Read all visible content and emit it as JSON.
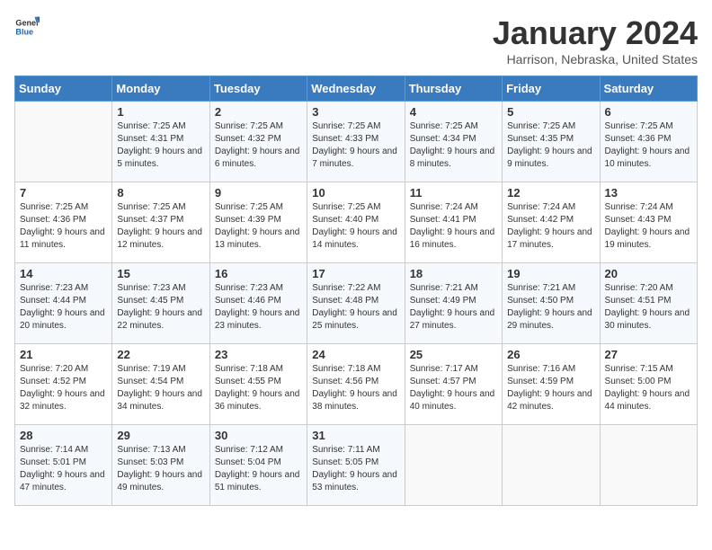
{
  "logo": {
    "text_general": "General",
    "text_blue": "Blue"
  },
  "header": {
    "month": "January 2024",
    "location": "Harrison, Nebraska, United States"
  },
  "weekdays": [
    "Sunday",
    "Monday",
    "Tuesday",
    "Wednesday",
    "Thursday",
    "Friday",
    "Saturday"
  ],
  "weeks": [
    [
      {
        "day": "",
        "sunrise": "",
        "sunset": "",
        "daylight": ""
      },
      {
        "day": "1",
        "sunrise": "Sunrise: 7:25 AM",
        "sunset": "Sunset: 4:31 PM",
        "daylight": "Daylight: 9 hours and 5 minutes."
      },
      {
        "day": "2",
        "sunrise": "Sunrise: 7:25 AM",
        "sunset": "Sunset: 4:32 PM",
        "daylight": "Daylight: 9 hours and 6 minutes."
      },
      {
        "day": "3",
        "sunrise": "Sunrise: 7:25 AM",
        "sunset": "Sunset: 4:33 PM",
        "daylight": "Daylight: 9 hours and 7 minutes."
      },
      {
        "day": "4",
        "sunrise": "Sunrise: 7:25 AM",
        "sunset": "Sunset: 4:34 PM",
        "daylight": "Daylight: 9 hours and 8 minutes."
      },
      {
        "day": "5",
        "sunrise": "Sunrise: 7:25 AM",
        "sunset": "Sunset: 4:35 PM",
        "daylight": "Daylight: 9 hours and 9 minutes."
      },
      {
        "day": "6",
        "sunrise": "Sunrise: 7:25 AM",
        "sunset": "Sunset: 4:36 PM",
        "daylight": "Daylight: 9 hours and 10 minutes."
      }
    ],
    [
      {
        "day": "7",
        "sunrise": "Sunrise: 7:25 AM",
        "sunset": "Sunset: 4:36 PM",
        "daylight": "Daylight: 9 hours and 11 minutes."
      },
      {
        "day": "8",
        "sunrise": "Sunrise: 7:25 AM",
        "sunset": "Sunset: 4:37 PM",
        "daylight": "Daylight: 9 hours and 12 minutes."
      },
      {
        "day": "9",
        "sunrise": "Sunrise: 7:25 AM",
        "sunset": "Sunset: 4:39 PM",
        "daylight": "Daylight: 9 hours and 13 minutes."
      },
      {
        "day": "10",
        "sunrise": "Sunrise: 7:25 AM",
        "sunset": "Sunset: 4:40 PM",
        "daylight": "Daylight: 9 hours and 14 minutes."
      },
      {
        "day": "11",
        "sunrise": "Sunrise: 7:24 AM",
        "sunset": "Sunset: 4:41 PM",
        "daylight": "Daylight: 9 hours and 16 minutes."
      },
      {
        "day": "12",
        "sunrise": "Sunrise: 7:24 AM",
        "sunset": "Sunset: 4:42 PM",
        "daylight": "Daylight: 9 hours and 17 minutes."
      },
      {
        "day": "13",
        "sunrise": "Sunrise: 7:24 AM",
        "sunset": "Sunset: 4:43 PM",
        "daylight": "Daylight: 9 hours and 19 minutes."
      }
    ],
    [
      {
        "day": "14",
        "sunrise": "Sunrise: 7:23 AM",
        "sunset": "Sunset: 4:44 PM",
        "daylight": "Daylight: 9 hours and 20 minutes."
      },
      {
        "day": "15",
        "sunrise": "Sunrise: 7:23 AM",
        "sunset": "Sunset: 4:45 PM",
        "daylight": "Daylight: 9 hours and 22 minutes."
      },
      {
        "day": "16",
        "sunrise": "Sunrise: 7:23 AM",
        "sunset": "Sunset: 4:46 PM",
        "daylight": "Daylight: 9 hours and 23 minutes."
      },
      {
        "day": "17",
        "sunrise": "Sunrise: 7:22 AM",
        "sunset": "Sunset: 4:48 PM",
        "daylight": "Daylight: 9 hours and 25 minutes."
      },
      {
        "day": "18",
        "sunrise": "Sunrise: 7:21 AM",
        "sunset": "Sunset: 4:49 PM",
        "daylight": "Daylight: 9 hours and 27 minutes."
      },
      {
        "day": "19",
        "sunrise": "Sunrise: 7:21 AM",
        "sunset": "Sunset: 4:50 PM",
        "daylight": "Daylight: 9 hours and 29 minutes."
      },
      {
        "day": "20",
        "sunrise": "Sunrise: 7:20 AM",
        "sunset": "Sunset: 4:51 PM",
        "daylight": "Daylight: 9 hours and 30 minutes."
      }
    ],
    [
      {
        "day": "21",
        "sunrise": "Sunrise: 7:20 AM",
        "sunset": "Sunset: 4:52 PM",
        "daylight": "Daylight: 9 hours and 32 minutes."
      },
      {
        "day": "22",
        "sunrise": "Sunrise: 7:19 AM",
        "sunset": "Sunset: 4:54 PM",
        "daylight": "Daylight: 9 hours and 34 minutes."
      },
      {
        "day": "23",
        "sunrise": "Sunrise: 7:18 AM",
        "sunset": "Sunset: 4:55 PM",
        "daylight": "Daylight: 9 hours and 36 minutes."
      },
      {
        "day": "24",
        "sunrise": "Sunrise: 7:18 AM",
        "sunset": "Sunset: 4:56 PM",
        "daylight": "Daylight: 9 hours and 38 minutes."
      },
      {
        "day": "25",
        "sunrise": "Sunrise: 7:17 AM",
        "sunset": "Sunset: 4:57 PM",
        "daylight": "Daylight: 9 hours and 40 minutes."
      },
      {
        "day": "26",
        "sunrise": "Sunrise: 7:16 AM",
        "sunset": "Sunset: 4:59 PM",
        "daylight": "Daylight: 9 hours and 42 minutes."
      },
      {
        "day": "27",
        "sunrise": "Sunrise: 7:15 AM",
        "sunset": "Sunset: 5:00 PM",
        "daylight": "Daylight: 9 hours and 44 minutes."
      }
    ],
    [
      {
        "day": "28",
        "sunrise": "Sunrise: 7:14 AM",
        "sunset": "Sunset: 5:01 PM",
        "daylight": "Daylight: 9 hours and 47 minutes."
      },
      {
        "day": "29",
        "sunrise": "Sunrise: 7:13 AM",
        "sunset": "Sunset: 5:03 PM",
        "daylight": "Daylight: 9 hours and 49 minutes."
      },
      {
        "day": "30",
        "sunrise": "Sunrise: 7:12 AM",
        "sunset": "Sunset: 5:04 PM",
        "daylight": "Daylight: 9 hours and 51 minutes."
      },
      {
        "day": "31",
        "sunrise": "Sunrise: 7:11 AM",
        "sunset": "Sunset: 5:05 PM",
        "daylight": "Daylight: 9 hours and 53 minutes."
      },
      {
        "day": "",
        "sunrise": "",
        "sunset": "",
        "daylight": ""
      },
      {
        "day": "",
        "sunrise": "",
        "sunset": "",
        "daylight": ""
      },
      {
        "day": "",
        "sunrise": "",
        "sunset": "",
        "daylight": ""
      }
    ]
  ]
}
